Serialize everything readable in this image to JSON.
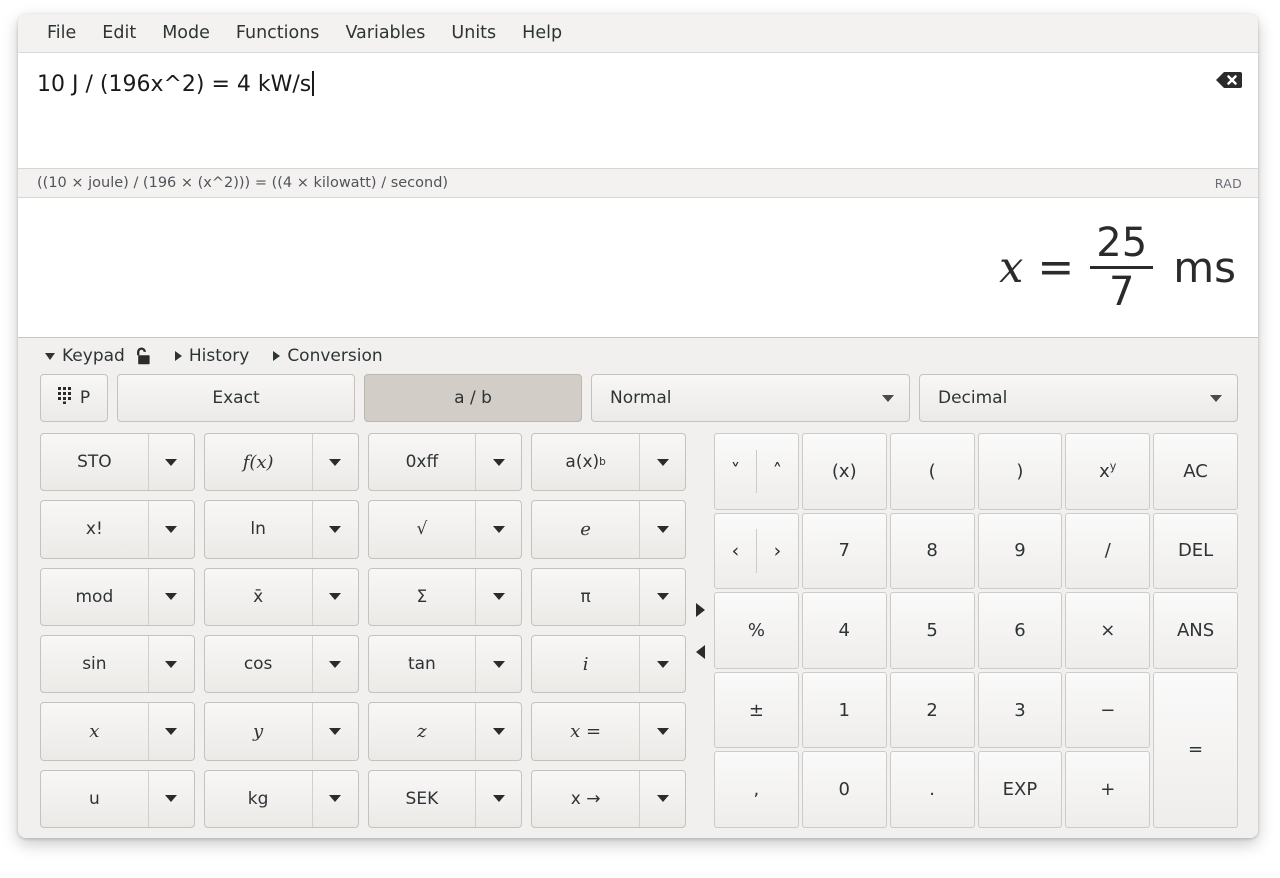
{
  "menu": {
    "items": [
      "File",
      "Edit",
      "Mode",
      "Functions",
      "Variables",
      "Units",
      "Help"
    ]
  },
  "entry": {
    "expression": "10 J / (196x^2) = 4 kW/s",
    "clear_icon": "backspace-clear-icon"
  },
  "status": {
    "parsed": "((10 × joule) / (196 × (x^2))) = ((4 × kilowatt) / second)",
    "angle_unit": "RAD"
  },
  "result": {
    "variable": "x",
    "equals": "=",
    "numerator": "25",
    "denominator": "7",
    "unit": "ms"
  },
  "panel_tabs": [
    {
      "label": "Keypad",
      "state": "expanded",
      "icon": "unlocked-padlock-icon"
    },
    {
      "label": "History",
      "state": "collapsed"
    },
    {
      "label": "Conversion",
      "state": "collapsed"
    }
  ],
  "mode_row": {
    "programming_label": "P",
    "programming_icon": "keypad-dots-icon",
    "exact_label": "Exact",
    "fraction_label": "a / b",
    "fraction_active": true,
    "notation_value": "Normal",
    "base_value": "Decimal"
  },
  "function_keys": [
    {
      "label": "STO",
      "italic": false
    },
    {
      "label": "f(x)",
      "italic": true
    },
    {
      "label": "0xff",
      "italic": false
    },
    {
      "label": "a(x)b",
      "italic": false,
      "sup": "b",
      "base": "a(x)"
    },
    {
      "label": "x!",
      "italic": false
    },
    {
      "label": "ln",
      "italic": false
    },
    {
      "label": "√",
      "italic": false
    },
    {
      "label": "e",
      "italic": true
    },
    {
      "label": "mod",
      "italic": false
    },
    {
      "label": "x̄",
      "italic": false
    },
    {
      "label": "Σ",
      "italic": false
    },
    {
      "label": "π",
      "italic": false
    },
    {
      "label": "sin",
      "italic": false
    },
    {
      "label": "cos",
      "italic": false
    },
    {
      "label": "tan",
      "italic": false
    },
    {
      "label": "i",
      "italic": true
    },
    {
      "label": "x",
      "italic": true
    },
    {
      "label": "y",
      "italic": true
    },
    {
      "label": "z",
      "italic": true
    },
    {
      "label": "x =",
      "italic": true
    },
    {
      "label": "u",
      "italic": false
    },
    {
      "label": "kg",
      "italic": false
    },
    {
      "label": "SEK",
      "italic": false
    },
    {
      "label": "x →",
      "italic": false
    }
  ],
  "side_arrows": {
    "next": "right-triangle-icon",
    "prev": "left-triangle-icon"
  },
  "numeric_keys": {
    "nav_vertical": {
      "down": "˅",
      "up": "˄"
    },
    "nav_horizontal": {
      "left": "‹",
      "right": "›"
    },
    "row1": [
      "(x)",
      "(",
      ")",
      "x^y",
      "AC"
    ],
    "row2": [
      "7",
      "8",
      "9",
      "/",
      "DEL"
    ],
    "row3": [
      "4",
      "5",
      "6",
      "×",
      "ANS"
    ],
    "row4": [
      "1",
      "2",
      "3",
      "−"
    ],
    "row5": [
      "0",
      ".",
      "EXP",
      "+"
    ],
    "percent": "%",
    "plusminus": "±",
    "comma": ",",
    "equals": "=",
    "power_base": "x",
    "power_exp": "y"
  },
  "colors": {
    "window_bg": "#f2f0ee",
    "entry_bg": "#ffffff",
    "active_button": "#d3cdc7",
    "text": "#2e3436",
    "border": "#c6c1bc"
  }
}
